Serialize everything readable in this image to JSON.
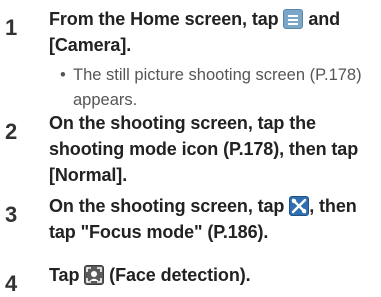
{
  "steps": [
    {
      "number": "1",
      "text_a": "From the Home screen, tap ",
      "text_b": " and [Camera].",
      "sub_bullet": "•",
      "sub_text": "The still picture shooting screen (P.178) appears."
    },
    {
      "number": "2",
      "text": "On the shooting screen, tap the shooting mode icon (P.178), then tap [Normal]."
    },
    {
      "number": "3",
      "text_a": "On the shooting screen, tap ",
      "text_b": ", then tap \"Focus mode\" (P.186)."
    },
    {
      "number": "4",
      "text_a": "Tap ",
      "text_b": " (Face detection)."
    }
  ],
  "icons": {
    "menu": "menu-icon",
    "settings": "camera-settings-icon",
    "face": "face-detection-icon"
  }
}
